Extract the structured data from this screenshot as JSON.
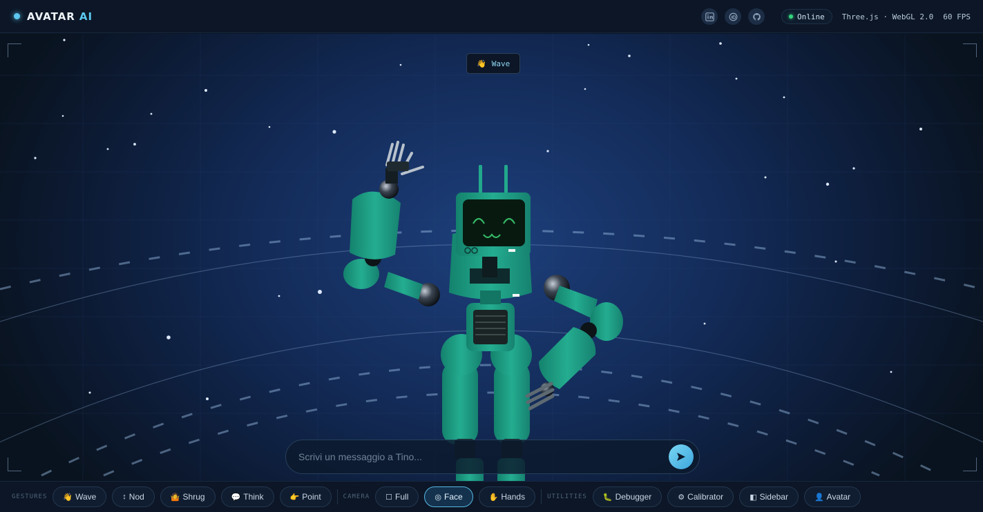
{
  "header": {
    "brand_main": "AVATAR",
    "brand_accent": "AI",
    "icons": [
      "linkedin-icon",
      "orcid-icon",
      "github-icon"
    ],
    "status": "Online",
    "engine": "Three.js · WebGL 2.0",
    "fps": "60 FPS"
  },
  "stage": {
    "gesture_tag": {
      "emoji": "👋",
      "label": "Wave"
    },
    "chat": {
      "placeholder": "Scrivi un messaggio a Tino...",
      "value": ""
    }
  },
  "toolbar": {
    "gestures_label": "GESTURES",
    "gestures": [
      {
        "icon": "👋",
        "label": "Wave"
      },
      {
        "icon": "↕",
        "label": "Nod"
      },
      {
        "icon": "🤷",
        "label": "Shrug"
      },
      {
        "icon": "💬",
        "label": "Think"
      },
      {
        "icon": "👉",
        "label": "Point"
      }
    ],
    "camera_label": "CAMERA",
    "camera": [
      {
        "icon": "☐",
        "label": "Full"
      },
      {
        "icon": "◎",
        "label": "Face",
        "active": true
      },
      {
        "icon": "✋",
        "label": "Hands"
      }
    ],
    "utilities_label": "UTILITIES",
    "utilities": [
      {
        "icon": "🐛",
        "label": "Debugger"
      },
      {
        "icon": "⚙",
        "label": "Calibrator"
      },
      {
        "icon": "◧",
        "label": "Sidebar"
      },
      {
        "icon": "👤",
        "label": "Avatar"
      }
    ]
  },
  "colors": {
    "accent": "#5cc8f0",
    "online": "#34d27c",
    "robot_body": "#1f9e84",
    "background": "#0b1424"
  }
}
